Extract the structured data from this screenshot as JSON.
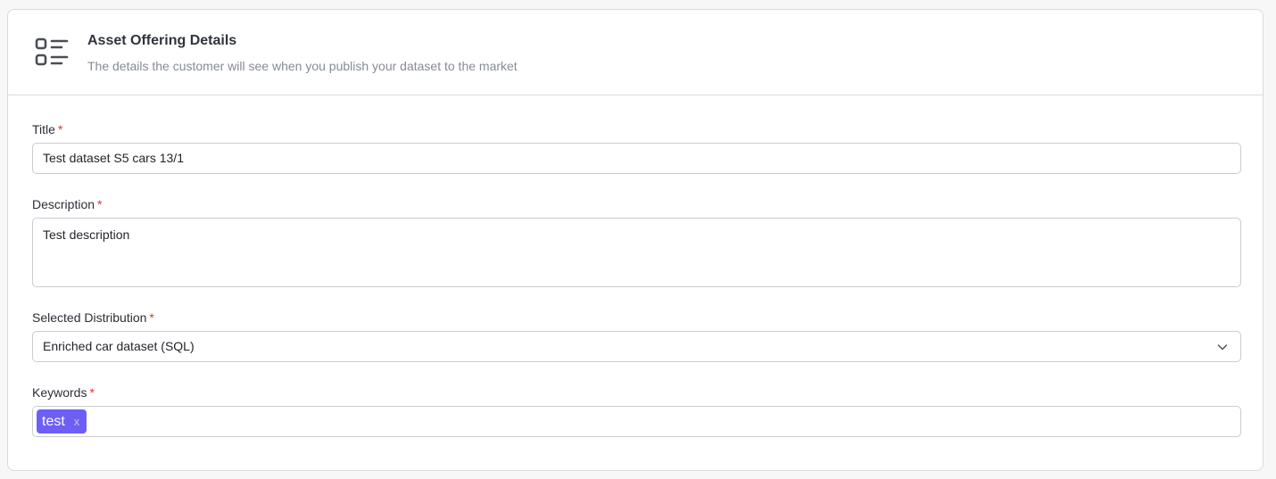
{
  "header": {
    "title": "Asset Offering Details",
    "subtitle": "The details the customer will see when you publish your dataset to the market",
    "icon": "list-details-icon"
  },
  "fields": {
    "title": {
      "label": "Title",
      "required_marker": "*",
      "value": "Test dataset S5 cars 13/1"
    },
    "description": {
      "label": "Description",
      "required_marker": "*",
      "value": "Test description"
    },
    "distribution": {
      "label": "Selected Distribution",
      "required_marker": "*",
      "value": "Enriched car dataset (SQL)"
    },
    "keywords": {
      "label": "Keywords",
      "required_marker": "*",
      "tags": [
        "test"
      ],
      "remove_symbol": "x"
    }
  },
  "colors": {
    "tag_background": "#6d5ff5",
    "required_marker": "#e0323b",
    "border": "#c9ccd2"
  }
}
